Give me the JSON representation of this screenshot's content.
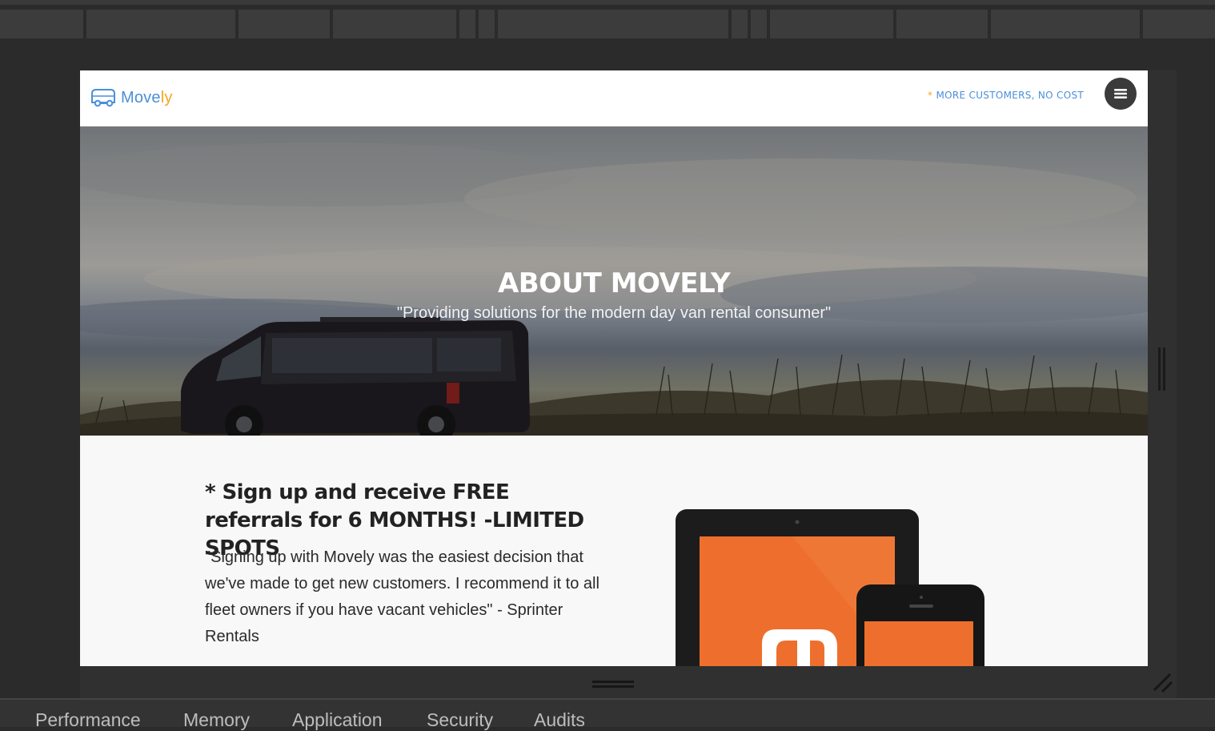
{
  "site": {
    "logo_text_main": "Move",
    "logo_text_accent": "ly",
    "promo_star": "*",
    "promo_text": "MORE CUSTOMERS, NO COST"
  },
  "hero": {
    "title": "ABOUT MOVELY",
    "subtitle": "\"Providing solutions for the modern day van rental consumer\""
  },
  "content": {
    "heading": "* Sign up and receive FREE referrals for 6 MONTHS! -LIMITED SPOTS",
    "testimonial": "\"Signing up with Movely was the easiest decision that we've made to get new customers. I recommend it to all fleet owners if you have vacant vehicles\" - Sprinter Rentals"
  },
  "devtools": {
    "tabs": [
      "Performance",
      "Memory",
      "Application",
      "Security",
      "Audits"
    ]
  },
  "colors": {
    "brand_blue": "#4a90d9",
    "brand_orange": "#f5a623",
    "device_screen_orange": "#ee6f2d"
  }
}
